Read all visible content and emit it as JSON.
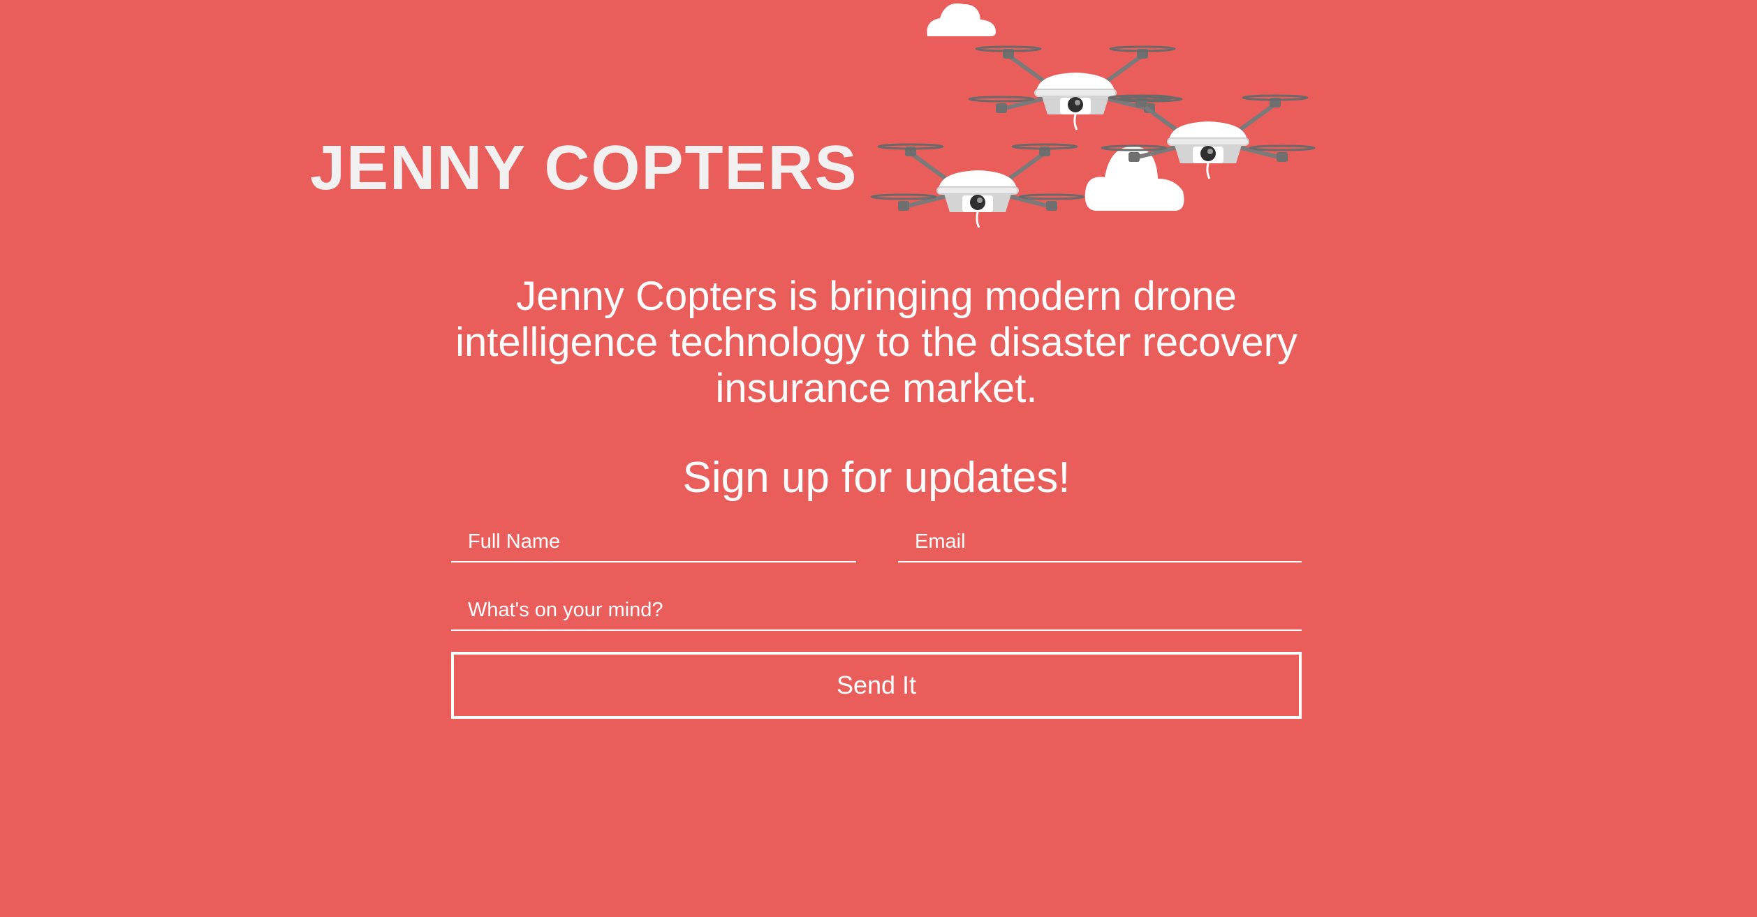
{
  "header": {
    "logo_text": "JENNY COPTERS"
  },
  "main": {
    "tagline": "Jenny Copters is bringing modern drone intelligence technology to the disaster recovery insurance market.",
    "signup_heading": "Sign up for updates!"
  },
  "form": {
    "name_placeholder": "Full Name",
    "email_placeholder": "Email",
    "message_placeholder": "What's on your mind?",
    "submit_label": "Send It"
  },
  "colors": {
    "background": "#e95e5b",
    "text": "#ffffff",
    "logo": "#f1f1f1"
  },
  "icons": [
    "cloud-icon",
    "drone-icon"
  ]
}
